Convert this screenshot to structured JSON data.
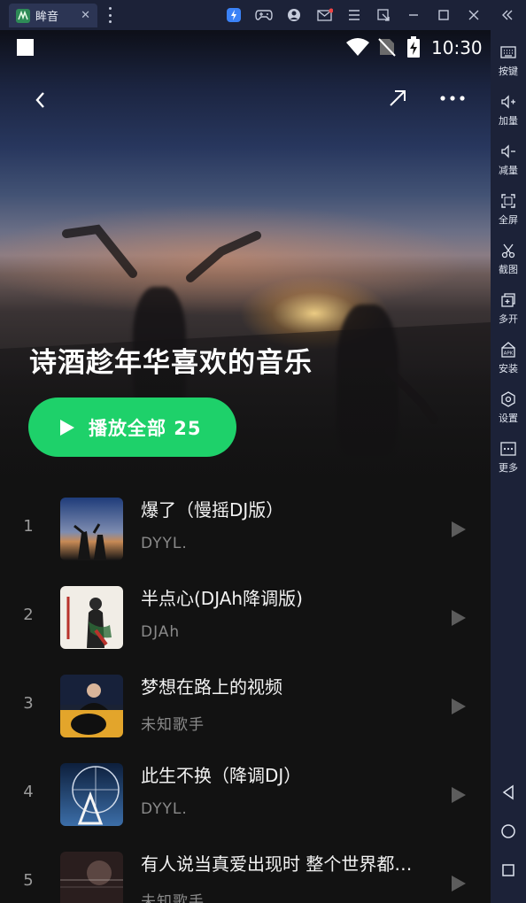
{
  "emulator": {
    "tab_title": "眸音",
    "side_items": [
      {
        "label": "按键",
        "icon": "keyboard-icon"
      },
      {
        "label": "加量",
        "icon": "volume-up-icon"
      },
      {
        "label": "减量",
        "icon": "volume-down-icon"
      },
      {
        "label": "全屏",
        "icon": "fullscreen-icon"
      },
      {
        "label": "截图",
        "icon": "scissors-icon"
      },
      {
        "label": "多开",
        "icon": "multi-instance-icon"
      },
      {
        "label": "安装",
        "icon": "apk-install-icon"
      },
      {
        "label": "设置",
        "icon": "settings-icon"
      },
      {
        "label": "更多",
        "icon": "more-icon"
      }
    ],
    "apk_badge": "APK"
  },
  "status_bar": {
    "time": "10:30"
  },
  "playlist": {
    "title": "诗酒趁年华喜欢的音乐",
    "play_all_label": "播放全部 25"
  },
  "songs": [
    {
      "index": "1",
      "title": "爆了（慢摇DJ版）",
      "artist": "DYYL."
    },
    {
      "index": "2",
      "title": "半点心(DJAh降调版)",
      "artist": "DJAh"
    },
    {
      "index": "3",
      "title": "梦想在路上的视频",
      "artist": "未知歌手"
    },
    {
      "index": "4",
      "title": "此生不换（降调DJ）",
      "artist": "DYYL."
    },
    {
      "index": "5",
      "title": "有人说当真爱出现时 整个世界都…",
      "artist": "未知歌手"
    }
  ],
  "colors": {
    "accent": "#1ed16a",
    "background": "#121212",
    "emulator_chrome": "#1c2238"
  }
}
